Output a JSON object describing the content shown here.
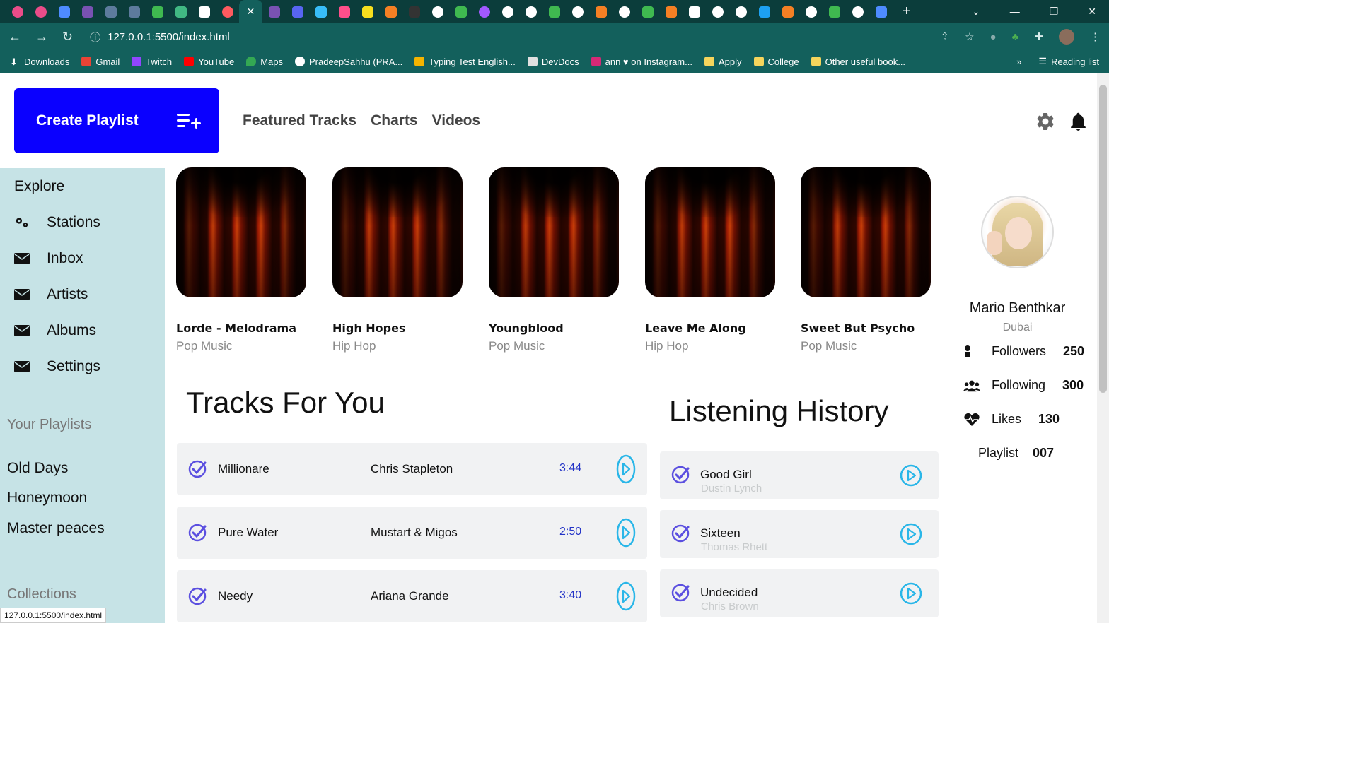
{
  "browser": {
    "url": "127.0.0.1:5500/index.html",
    "status_url": "127.0.0.1:5500/index.html",
    "bookmarks": [
      {
        "label": "Downloads",
        "color": "#ffffff"
      },
      {
        "label": "Gmail",
        "color": "#ea4335"
      },
      {
        "label": "Twitch",
        "color": "#9146ff"
      },
      {
        "label": "YouTube",
        "color": "#ff0000"
      },
      {
        "label": "Maps",
        "color": "#34a853"
      },
      {
        "label": "PradeepSahhu (PRA...",
        "color": "#ffffff"
      },
      {
        "label": "Typing Test English...",
        "color": "#f4b400"
      },
      {
        "label": "DevDocs",
        "color": "#e0e0e0"
      },
      {
        "label": "ann ♥ on Instagram...",
        "color": "#d62976"
      },
      {
        "label": "Apply",
        "color": "#f6d55c"
      },
      {
        "label": "College",
        "color": "#f6d55c"
      },
      {
        "label": "Other useful book...",
        "color": "#f6d55c"
      }
    ],
    "more_bookmarks": "»",
    "reading_list": "Reading list"
  },
  "header": {
    "create_playlist": "Create Playlist",
    "nav": [
      "Featured Tracks",
      "Charts",
      "Videos"
    ]
  },
  "sidebar": {
    "explore": "Explore",
    "items": [
      "Stations",
      "Inbox",
      "Artists",
      "Albums",
      "Settings"
    ],
    "playlists_heading": "Your Playlists",
    "playlists": [
      "Old Days",
      "Honeymoon",
      "Master peaces"
    ],
    "collections_heading": "Collections"
  },
  "featured": [
    {
      "title": "Lorde - Melodrama",
      "genre": "Pop Music"
    },
    {
      "title": "High Hopes",
      "genre": "Hip Hop"
    },
    {
      "title": "Youngblood",
      "genre": "Pop Music"
    },
    {
      "title": "Leave Me Along",
      "genre": "Hip Hop"
    },
    {
      "title": "Sweet But Psycho",
      "genre": "Pop Music"
    }
  ],
  "tracks": {
    "heading": "Tracks For You",
    "rows": [
      {
        "name": "Millionare",
        "artist": "Chris Stapleton",
        "duration": "3:44"
      },
      {
        "name": "Pure Water",
        "artist": "Mustart & Migos",
        "duration": "2:50"
      },
      {
        "name": "Needy",
        "artist": "Ariana Grande",
        "duration": "3:40"
      }
    ]
  },
  "history": {
    "heading": "Listening History",
    "rows": [
      {
        "name": "Good Girl",
        "artist": "Dustin Lynch"
      },
      {
        "name": "Sixteen",
        "artist": "Thomas Rhett"
      },
      {
        "name": "Undecided",
        "artist": "Chris Brown"
      }
    ]
  },
  "profile": {
    "name": "Mario Benthkar",
    "city": "Dubai",
    "followers_label": "Followers",
    "followers": "250",
    "following_label": "Following",
    "following": "300",
    "likes_label": "Likes",
    "likes": "130",
    "playlist_label": "Playlist",
    "playlist": "007"
  },
  "colors": {
    "accent": "#0a00ff",
    "sidebar_bg": "#c6e3e6",
    "play_icon": "#29b6e8",
    "check_icon": "#5b4fe0",
    "duration": "#2434c7"
  }
}
